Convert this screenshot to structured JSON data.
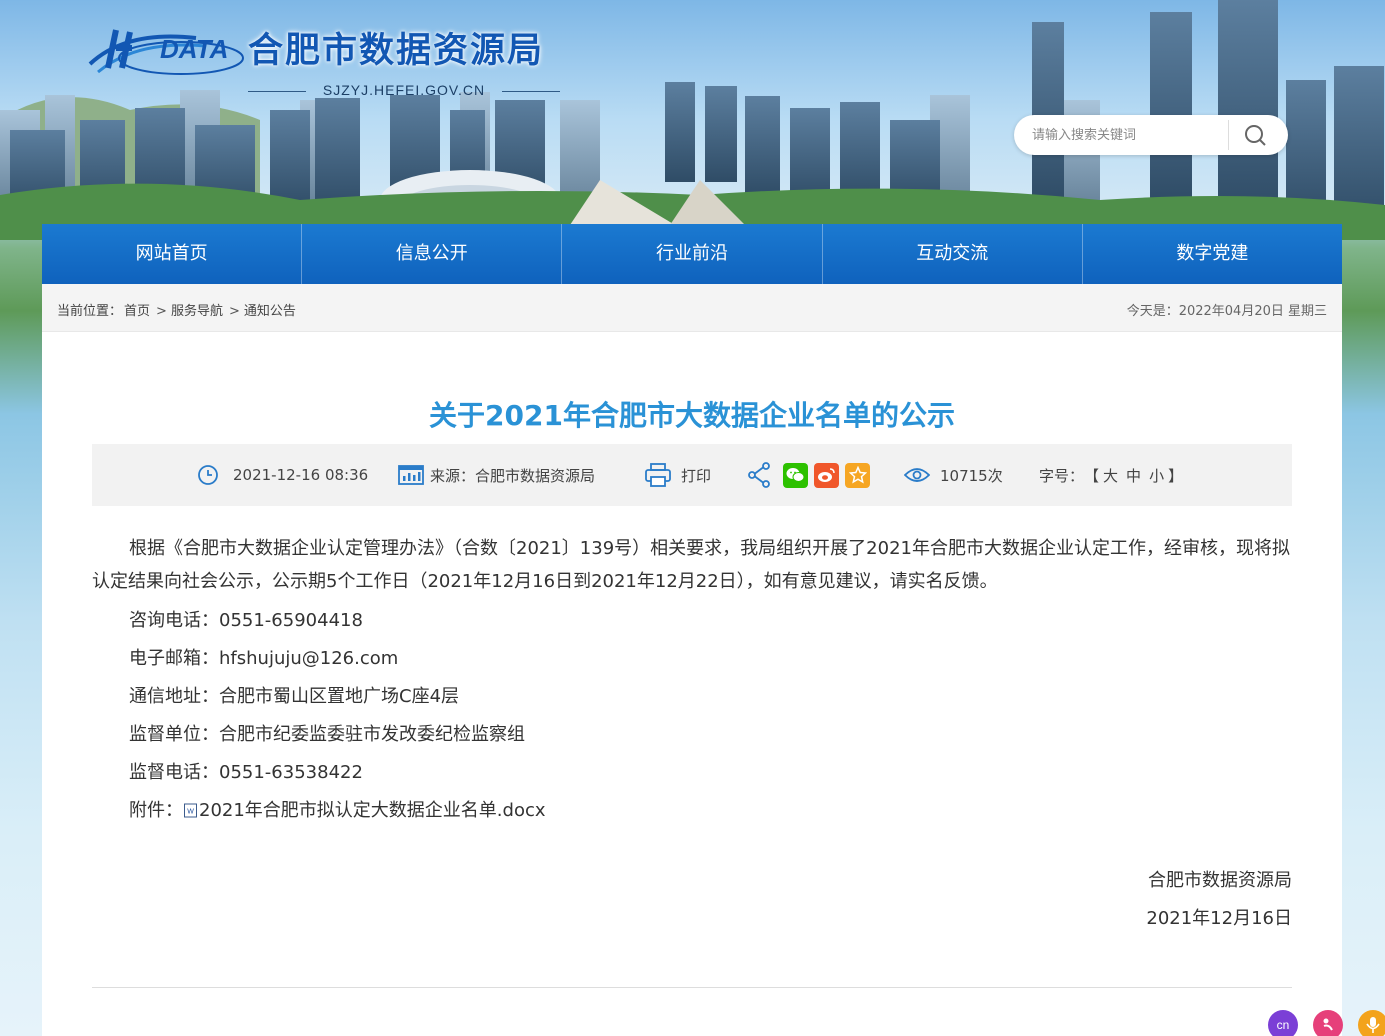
{
  "site": {
    "logo_mark_text": "DATA",
    "title": "合肥市数据资源局",
    "domain": "SJZYJ.HEFEI.GOV.CN"
  },
  "search": {
    "placeholder": "请输入搜索关键词"
  },
  "nav": {
    "items": [
      {
        "label": "网站首页"
      },
      {
        "label": "信息公开"
      },
      {
        "label": "行业前沿"
      },
      {
        "label": "互动交流"
      },
      {
        "label": "数字党建"
      }
    ]
  },
  "breadcrumb": {
    "prefix": "当前位置：",
    "items": [
      "首页",
      "服务导航",
      "通知公告"
    ],
    "separator": ">",
    "today": "今天是：2022年04月20日 星期三"
  },
  "article": {
    "title": "关于2021年合肥市大数据企业名单的公示",
    "meta": {
      "date": "2021-12-16 08:36",
      "source": "来源：合肥市数据资源局",
      "print": "打印",
      "views": "10715次",
      "font_label": "字号：",
      "font_open": "【",
      "font_close": "】",
      "font_sizes": [
        "大",
        "中",
        "小"
      ]
    },
    "intro": "根据《合肥市大数据企业认定管理办法》（合数〔2021〕139号）相关要求，我局组织开展了2021年合肥市大数据企业认定工作，经审核，现将拟认定结果向社会公示，公示期5个工作日（2021年12月16日到2021年12月22日），如有意见建议，请实名反馈。",
    "lines": [
      "咨询电话：0551-65904418",
      "电子邮箱：hfshujuju@126.com",
      "通信地址：合肥市蜀山区置地广场C座4层",
      "监督单位：合肥市纪委监委驻市发改委纪检监察组",
      "监督电话：0551-63538422"
    ],
    "attachment_label": "附件：",
    "attachment_name": "2021年合肥市拟认定大数据企业名单.docx",
    "signature_org": "合肥市数据资源局",
    "signature_date": "2021年12月16日"
  },
  "tools": {
    "lang_label": "cn"
  },
  "colors": {
    "nav_bg": "#1b7ad1",
    "title_blue": "#2a92d6",
    "wechat": "#2dc100",
    "weibo": "#f0572b",
    "favorite": "#f6a623"
  }
}
